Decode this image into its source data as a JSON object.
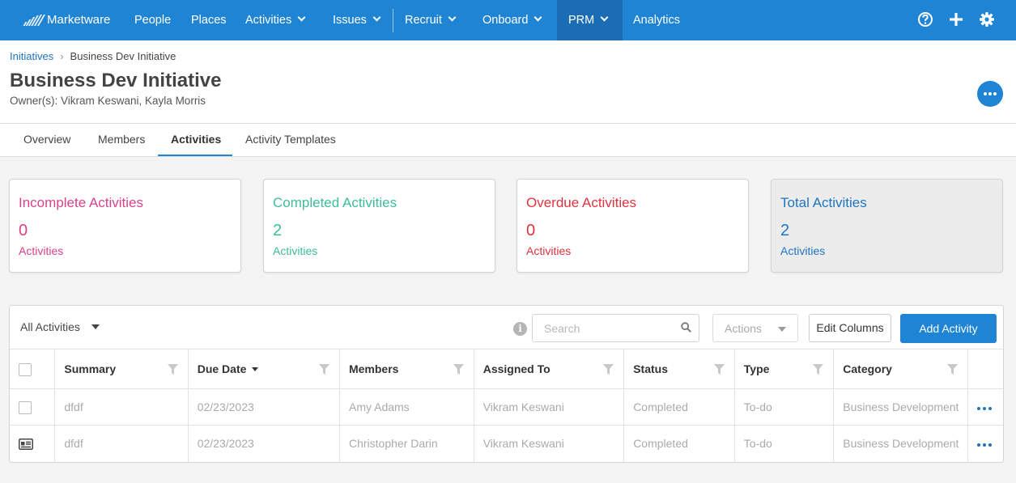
{
  "nav": {
    "brand": "Marketware",
    "items": [
      {
        "label": "People",
        "dropdown": false
      },
      {
        "label": "Places",
        "dropdown": false
      },
      {
        "label": "Activities",
        "dropdown": true
      },
      {
        "label": "Issues",
        "dropdown": true
      },
      {
        "label": "Recruit",
        "dropdown": true
      },
      {
        "label": "Onboard",
        "dropdown": true
      },
      {
        "label": "PRM",
        "dropdown": true,
        "active": true
      },
      {
        "label": "Analytics",
        "dropdown": false
      }
    ],
    "icons": [
      "help-icon",
      "plus-icon",
      "gear-icon"
    ]
  },
  "breadcrumb": {
    "parent": "Initiatives",
    "separator": "›",
    "current": "Business Dev Initiative"
  },
  "page": {
    "title": "Business Dev Initiative",
    "owners": "Owner(s): Vikram Keswani, Kayla Morris"
  },
  "tabs": [
    {
      "label": "Overview",
      "active": false
    },
    {
      "label": "Members",
      "active": false
    },
    {
      "label": "Activities",
      "active": true
    },
    {
      "label": "Activity Templates",
      "active": false
    }
  ],
  "cards": [
    {
      "title": "Incomplete Activities",
      "value": "0",
      "unit": "Activities",
      "color": "#d9428a"
    },
    {
      "title": "Completed Activities",
      "value": "2",
      "unit": "Activities",
      "color": "#3dbd9a"
    },
    {
      "title": "Overdue Activities",
      "value": "0",
      "unit": "Activities",
      "color": "#e0333f"
    },
    {
      "title": "Total Activities",
      "value": "2",
      "unit": "Activities",
      "color": "#1f74c0"
    }
  ],
  "table_toolbar": {
    "filter": "All Activities",
    "search_placeholder": "Search",
    "actions": "Actions",
    "edit_columns": "Edit Columns",
    "add_activity": "Add Activity"
  },
  "table": {
    "columns": [
      "Summary",
      "Due Date",
      "Members",
      "Assigned To",
      "Status",
      "Type",
      "Category"
    ],
    "sorted_column": "Due Date",
    "rows": [
      {
        "summary": "dfdf",
        "due": "02/23/2023",
        "members": "Amy Adams",
        "assigned": "Vikram Keswani",
        "status": "Completed",
        "type": "To-do",
        "category": "Business Development",
        "row_icon": "checkbox"
      },
      {
        "summary": "dfdf",
        "due": "02/23/2023",
        "members": "Christopher Darin",
        "assigned": "Vikram Keswani",
        "status": "Completed",
        "type": "To-do",
        "category": "Business Development",
        "row_icon": "contact-card-icon"
      }
    ]
  },
  "colors": {
    "primary": "#1f84d4",
    "nav_active": "#1a6db4",
    "link": "#1f74c0"
  }
}
